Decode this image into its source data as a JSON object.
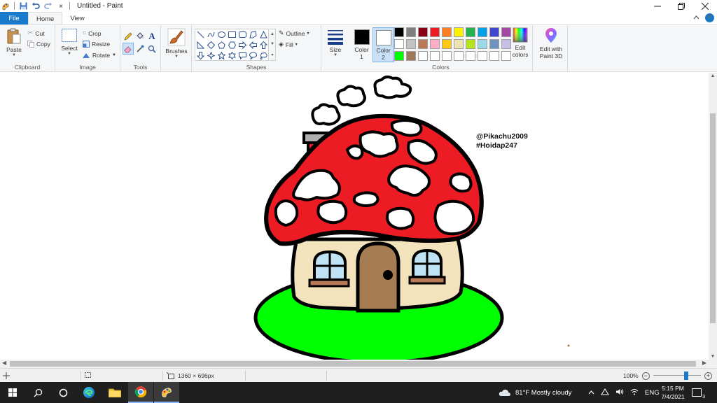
{
  "window": {
    "title": "Untitled - Paint",
    "qat_separator": "|",
    "qat_dropdown": "⩙"
  },
  "tabs": {
    "file": "File",
    "home": "Home",
    "view": "View"
  },
  "ribbon": {
    "clipboard": {
      "paste": "Paste",
      "cut": "Cut",
      "copy": "Copy",
      "label": "Clipboard"
    },
    "image": {
      "select": "Select",
      "crop": "Crop",
      "resize": "Resize",
      "rotate": "Rotate",
      "label": "Image"
    },
    "tools": {
      "label": "Tools"
    },
    "brushes": {
      "label": "Brushes"
    },
    "shapes": {
      "outline": "Outline",
      "fill": "Fill",
      "label": "Shapes"
    },
    "size": {
      "label": "Size"
    },
    "colors": {
      "color1": "Color\n1",
      "color2": "Color\n2",
      "edit_colors": "Edit\ncolors",
      "label": "Colors",
      "color1_value": "#000000",
      "color2_value": "#ffffff",
      "palette": [
        "#000000",
        "#7f7f7f",
        "#880015",
        "#ed1c24",
        "#ff7f27",
        "#fff200",
        "#22b14c",
        "#00a2e8",
        "#3f48cc",
        "#a349a4",
        "#ffffff",
        "#c3c3c3",
        "#b97a57",
        "#ffaec9",
        "#ffc90e",
        "#efe4b0",
        "#b5e61d",
        "#99d9ea",
        "#7092be",
        "#c8bfe7",
        "#00ff00",
        "#a0785a",
        "#ffffff",
        "#ffffff",
        "#ffffff",
        "#ffffff",
        "#ffffff",
        "#ffffff",
        "#ffffff",
        "#ffffff"
      ]
    },
    "paint3d": {
      "label": "Edit with\nPaint 3D"
    }
  },
  "canvas": {
    "watermark_line1": "@Pikachu2009",
    "watermark_line2": "#Hoidap247",
    "colors": {
      "red": "#ed1c24",
      "green": "#00ff00",
      "cream": "#f2e3bd",
      "door": "#a67c52",
      "window": "#bfe3f5",
      "sill": "#b97a57",
      "chimney": "#b0b0b0"
    }
  },
  "statusbar": {
    "dimensions": "1360 × 696px",
    "zoom": "100%"
  },
  "taskbar": {
    "weather": "81°F  Mostly cloudy",
    "lang": "ENG",
    "time": "5:15 PM",
    "date": "7/4/2021",
    "notifications": "3"
  }
}
